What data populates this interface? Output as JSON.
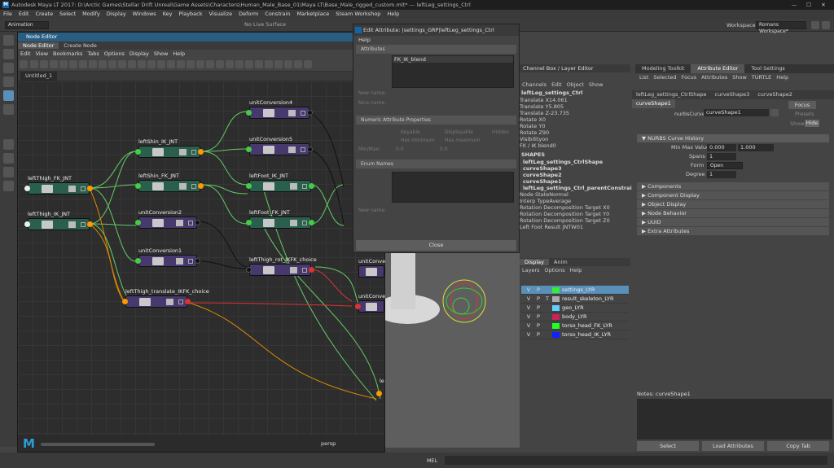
{
  "window": {
    "title": "Autodesk Maya LT 2017: D:\\Arctic Games\\Stellar Drift Unreal\\Game Assets\\Characters\\Human_Male_Base_01\\Maya LT\\Base_Male_rigged_custom.mlt*  ---  leftLeg_settings_Ctrl",
    "logo": "M"
  },
  "main_menu": [
    "File",
    "Edit",
    "Create",
    "Select",
    "Modify",
    "Display",
    "Windows",
    "Key",
    "Playback",
    "Visualize",
    "Deform",
    "Constrain",
    "Marketplace",
    "Steam Workshop",
    "Help"
  ],
  "shelf": {
    "mode": "Animation",
    "no_live": "No Live Surface",
    "workspace_label": "Workspace :",
    "workspace": "Romans Workspace*"
  },
  "node_editor": {
    "title": "Node Editor",
    "tabs": [
      "Node Editor",
      "Create Node"
    ],
    "menu": [
      "Edit",
      "View",
      "Bookmarks",
      "Tabs",
      "Options",
      "Display",
      "Show",
      "Help"
    ],
    "graph_tab": "Untitled_1",
    "nodes": {
      "n1": "leftThigh_FK_JNT",
      "n2": "leftThigh_IK_JNT",
      "n3": "leftShin_IK_JNT",
      "n4": "leftShin_FK_JNT",
      "n5": "unitConversion2",
      "n6": "unitConversion1",
      "n7": "leftThigh_translate_IKFK_choice",
      "n8": "unitConversion4",
      "n9": "unitConversion5",
      "n10": "leftFoot_IK_JNT",
      "n11": "leftFoot_FK_JNT",
      "n12": "leftThigh_rot_IKFK_choice",
      "n13": "unitConve",
      "n14": "unitConve",
      "n15": "le"
    },
    "persp": "persp"
  },
  "edit_attr": {
    "title": "Edit Attribute: |settings_GRP|leftLeg_settings_Ctrl",
    "help": "Help",
    "attributes": "Attributes",
    "selected_attr": "FK_IK_blend",
    "new_name": "New name:",
    "nice_name": "Nice name:",
    "numeric_section": "Numeric Attribute Properties",
    "keyable": "Keyable",
    "displayable": "Displayable",
    "hidden": "Hidden",
    "has_min": "Has minimum",
    "has_max": "Has maximum",
    "minmax": "Min/Max:",
    "min": "0.0",
    "max": "0.0",
    "enum_section": "Enum Names",
    "enum_new": "New name:",
    "close": "Close"
  },
  "channel_box": {
    "tab": "Channel Box / Layer Editor",
    "menu": [
      "Channels",
      "Edit",
      "Object",
      "Show"
    ],
    "object": "leftLeg_settings_Ctrl",
    "attrs": [
      {
        "n": "Translate X",
        "v": "14.061"
      },
      {
        "n": "Translate Y",
        "v": "5.805"
      },
      {
        "n": "Translate Z",
        "v": "-23.735"
      },
      {
        "n": "Rotate X",
        "v": "0"
      },
      {
        "n": "Rotate Y",
        "v": "0"
      },
      {
        "n": "Rotate Z",
        "v": "90"
      },
      {
        "n": "Visibility",
        "v": "on"
      },
      {
        "n": "FK / IK blend",
        "v": "0"
      }
    ],
    "shapes_label": "SHAPES",
    "shapes": [
      "leftLeg_settings_CtrlShape",
      "curveShape3",
      "curveShape2",
      "curveShape1",
      "leftLeg_settings_Ctrl_parentConstraint1"
    ],
    "cattrs": [
      {
        "n": "Node State",
        "v": "Normal"
      },
      {
        "n": "Interp Type",
        "v": "Average"
      },
      {
        "n": "Rotation Decomposition Target X",
        "v": "0"
      },
      {
        "n": "Rotation Decomposition Target Y",
        "v": "0"
      },
      {
        "n": "Rotation Decomposition Target Z",
        "v": "0"
      },
      {
        "n": "Left Foot Result JNTW0",
        "v": "1"
      }
    ]
  },
  "layers": {
    "tabs": [
      "Display",
      "Anim"
    ],
    "menu": [
      "Layers",
      "Options",
      "Help"
    ],
    "items": [
      {
        "name": "settings_LYR",
        "color": "#33ee33"
      },
      {
        "name": "result_skeleton_LYR",
        "color": "#aaaaaa"
      },
      {
        "name": "geo_LYR",
        "color": "#66ccff"
      },
      {
        "name": "body_LYR",
        "color": "#cc2255"
      },
      {
        "name": "torso_head_FK_LYR",
        "color": "#22ff22"
      },
      {
        "name": "torso_head_IK_LYR",
        "color": "#1122ff"
      }
    ]
  },
  "attr_editor": {
    "right_tabs": [
      "Modeling Toolkit",
      "Attribute Editor",
      "Tool Settings"
    ],
    "menu": [
      "List",
      "Selected",
      "Focus",
      "Attributes",
      "Show",
      "TURTLE",
      "Help"
    ],
    "tabs": [
      "leftLeg_settings_CtrlShape",
      "curveShape3",
      "curveShape2",
      "curveShape1"
    ],
    "nurbs_label": "nurbsCurve:",
    "nurbs_value": "curveShape1",
    "focus": "Focus",
    "presets": "Presets",
    "show": "Show",
    "hide": "Hide",
    "history": "NURBS Curve History",
    "minmax_label": "Min Max Value",
    "min": "0.000",
    "max": "1.000",
    "spans_label": "Spans",
    "spans": "1",
    "form_label": "Form",
    "form": "Open",
    "degree_label": "Degree",
    "degree": "1",
    "sections": [
      "Components",
      "Component Display",
      "Object Display",
      "Node Behavior",
      "UUID",
      "Extra Attributes"
    ],
    "notes": "Notes:  curveShape1",
    "buttons": [
      "Select",
      "Load Attributes",
      "Copy Tab"
    ]
  },
  "status": {
    "mel": "MEL"
  }
}
